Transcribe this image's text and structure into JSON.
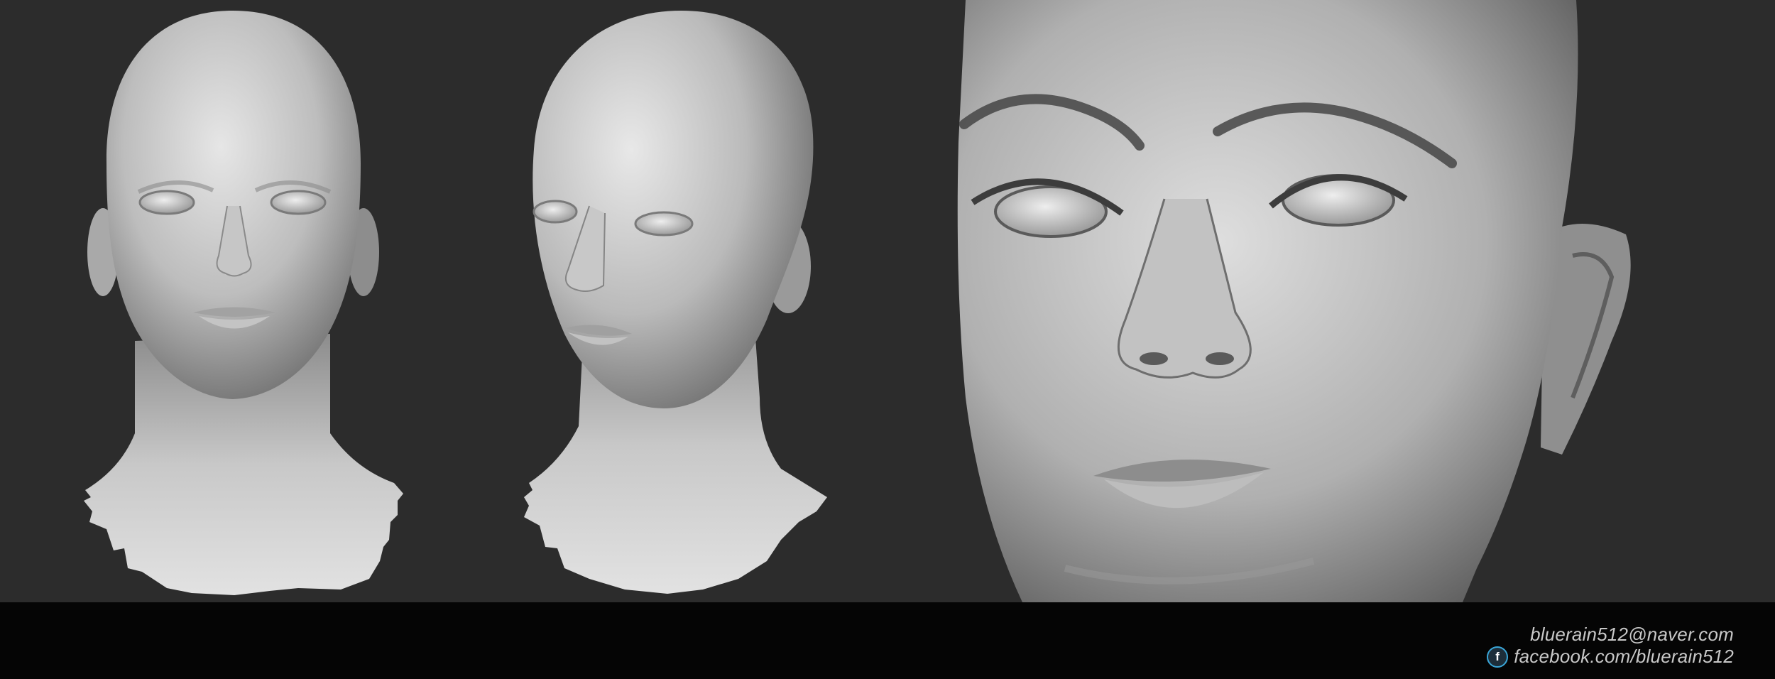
{
  "artwork": {
    "views": [
      {
        "name": "front-view",
        "label": ""
      },
      {
        "name": "three-quarter-view",
        "label": ""
      },
      {
        "name": "closeup-view",
        "label": ""
      }
    ],
    "colors": {
      "background": "#2c2c2c",
      "footer": "#050505",
      "clay_light": "#d9d9d9",
      "clay_shadow": "#6e6e6e",
      "text": "#c8c8c8",
      "facebook_ring": "#3aa6d8"
    }
  },
  "footer": {
    "email": "bluerain512@naver.com",
    "facebook_icon": "facebook-icon",
    "facebook_glyph": "f",
    "facebook": "facebook.com/bluerain512"
  }
}
